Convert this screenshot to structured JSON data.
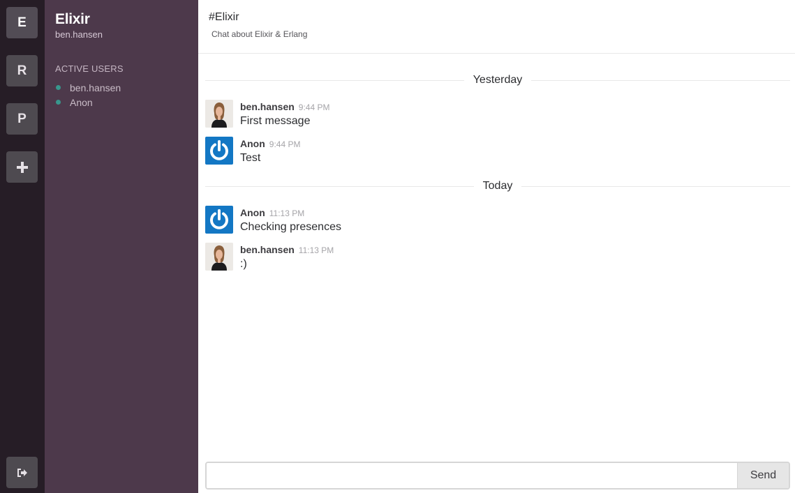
{
  "rail": {
    "teams": [
      {
        "label": "E",
        "active": true
      },
      {
        "label": "R",
        "active": false
      },
      {
        "label": "P",
        "active": false
      }
    ],
    "add_icon": "plus-icon",
    "logout_icon": "sign-out-icon"
  },
  "sidebar": {
    "team_name": "Elixir",
    "current_user": "ben.hansen",
    "active_users_title": "ACTIVE USERS",
    "active_users": [
      "ben.hansen",
      "Anon"
    ]
  },
  "header": {
    "channel": "#Elixir",
    "topic": "Chat about Elixir & Erlang"
  },
  "messages": {
    "day1": "Yesterday",
    "day2": "Today",
    "items": [
      {
        "author": "ben.hansen",
        "time": "9:44 PM",
        "text": "First message",
        "avatar": "photo"
      },
      {
        "author": "Anon",
        "time": "9:44 PM",
        "text": "Test",
        "avatar": "anon-power-icon"
      },
      {
        "author": "Anon",
        "time": "11:13 PM",
        "text": "Checking presences",
        "avatar": "anon-power-icon"
      },
      {
        "author": "ben.hansen",
        "time": "11:13 PM",
        "text": ":)",
        "avatar": "photo"
      }
    ]
  },
  "composer": {
    "value": "",
    "placeholder": "",
    "send_label": "Send"
  },
  "colors": {
    "rail_bg": "#261d26",
    "sidebar_bg": "#4d394b",
    "presence": "#38978d",
    "anon_avatar": "#1377c4"
  }
}
